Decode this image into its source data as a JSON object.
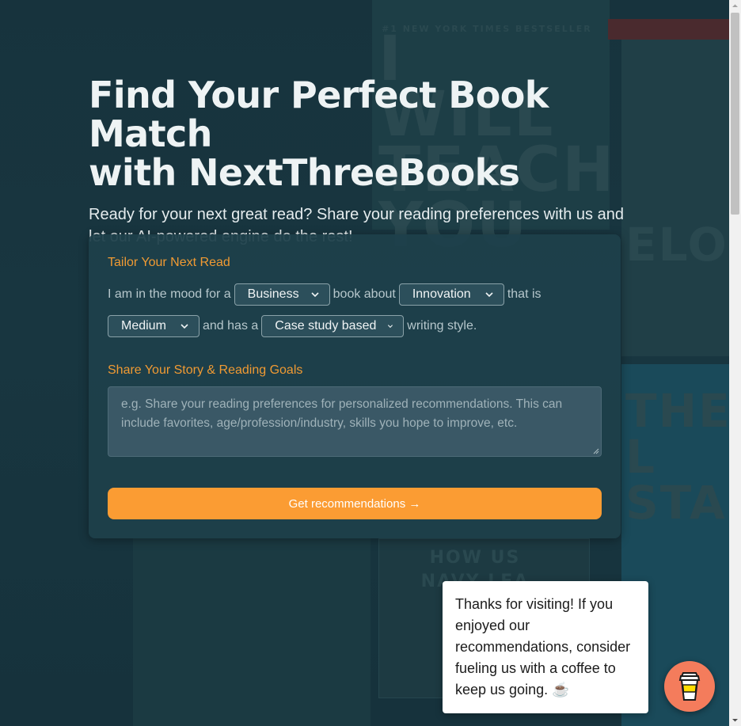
{
  "hero": {
    "title_line1": "Find Your Perfect Book Match",
    "title_line2": "with NextThreeBooks",
    "subtitle": "Ready for your next great read? Share your reading preferences with us and let our AI-powered engine do the rest!"
  },
  "form": {
    "section1_title": "Tailor Your Next Read",
    "sentence": {
      "w1": "I am in the mood for a",
      "w2": "book about",
      "w3": "that is",
      "w4": "and has a",
      "w5": "writing style."
    },
    "selects": {
      "genre": "Business",
      "topic": "Innovation",
      "length": "Medium",
      "style": "Case study based"
    },
    "section2_title": "Share Your Story & Reading Goals",
    "story_placeholder": "e.g. Share your reading preferences for personalized recommendations. This can include favorites, age/profession/industry, skills you hope to improve, etc.",
    "submit_label": "Get recommendations →"
  },
  "popup": {
    "message": "Thanks for visiting! If you enjoyed our recommendations, consider fueling us with a coffee to keep us going. ☕"
  },
  "background_text": {
    "bestseller": "#1 NEW YORK TIMES BESTSELLER",
    "book1": "I WILL TEACH YOU",
    "book2": "ELON M",
    "book3": "THE L STAR",
    "book4": "HOW US NAVY LEA"
  },
  "icons": {
    "chevron": "chevron-down-icon",
    "coffee": "coffee-cup-icon"
  },
  "colors": {
    "accent": "#fb9c33",
    "section_title": "#f09a33",
    "coffee_button": "#f47c5c"
  }
}
